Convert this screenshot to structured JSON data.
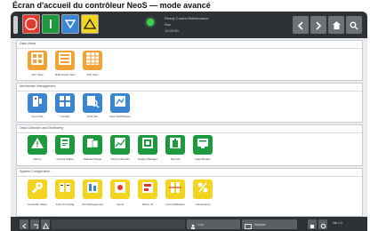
{
  "caption": "Écran d'accueil du contrôleur NeoS — mode avancé",
  "header": {
    "status_line1": "Ready Control Maintenance",
    "status_line2": "Run",
    "status_line3": "12:00:00"
  },
  "sections": {
    "s1": {
      "title": "Data Views",
      "tiles": [
        {
          "label": "Run View"
        },
        {
          "label": "Multi Group View"
        },
        {
          "label": "Text View"
        }
      ]
    },
    "s2": {
      "title": "Mechanism Management",
      "tiles": [
        {
          "label": "Go to File"
        },
        {
          "label": "Transfer"
        },
        {
          "label": "Find File"
        },
        {
          "label": "View Tool/Routine"
        }
      ]
    },
    "s3": {
      "title": "Data Collection and Monitoring",
      "tiles": [
        {
          "label": "Alarms"
        },
        {
          "label": "Control Status"
        },
        {
          "label": "Data Exchange"
        },
        {
          "label": "Trend Collection"
        },
        {
          "label": "Supply Manager"
        },
        {
          "label": "Tool Life"
        },
        {
          "label": "Data Monitor"
        }
      ]
    },
    "s4": {
      "title": "System Configuration",
      "tiles": [
        {
          "label": "Controller Setup"
        },
        {
          "label": "Joint I/O Config"
        },
        {
          "label": "Tool Management"
        },
        {
          "label": "Inputs"
        },
        {
          "label": "Macro IO"
        },
        {
          "label": "Limit Calibration"
        },
        {
          "label": "Conversions"
        }
      ]
    }
  },
  "footer": {
    "tab_label": "Live",
    "mode_label": "Machine",
    "info": "Info 1.0"
  },
  "colors": {
    "orange": "#f2a233",
    "blue": "#3a86d4",
    "green": "#1c9a3d",
    "yellow": "#f3d41f",
    "stop_red": "#e23a2e",
    "status_green": "#37d24a"
  },
  "icons": {
    "header": [
      "stop-icon",
      "status-green-icon",
      "down-triangle-icon",
      "warning-triangle-icon",
      "back-arrow-icon",
      "forward-arrow-icon",
      "home-icon",
      "search-icon"
    ],
    "footer": [
      "back-icon",
      "undo-icon",
      "warning-icon",
      "user-icon",
      "machine-icon",
      "stop-icon",
      "settings-icon"
    ]
  }
}
